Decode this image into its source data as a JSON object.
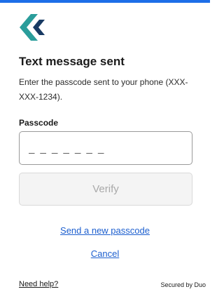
{
  "colors": {
    "accent_bar": "#1d6ee8",
    "logo_primary": "#2a9d9b",
    "logo_secondary": "#183a63",
    "link": "#1d5fcf"
  },
  "logo": {
    "icon": "duo-chevron-logo"
  },
  "main": {
    "title": "Text message sent",
    "instructions": "Enter the passcode sent to your phone (XXX-XXX-1234).",
    "passcode_label": "Passcode",
    "passcode_value": "",
    "passcode_placeholder": "_ _ _ _ _ _ _",
    "verify_label": "Verify",
    "send_new_label": "Send a new passcode",
    "cancel_label": "Cancel"
  },
  "footer": {
    "help_label": "Need help?",
    "secured_by": "Secured by Duo"
  }
}
